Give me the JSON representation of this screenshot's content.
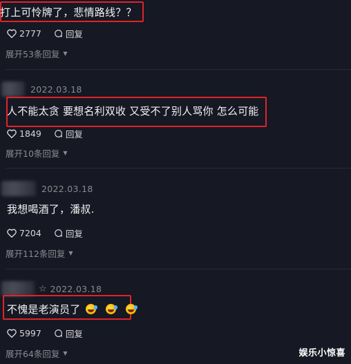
{
  "comments": [
    {
      "date": "",
      "text": "打上可怜牌了，悲情路线？？",
      "likes": "2777",
      "reply_label": "回复",
      "expand": "展开53条回复"
    },
    {
      "date": "2022.03.18",
      "text": "人不能太贪 要想名利双收 又受不了别人骂你 怎么可能",
      "likes": "1849",
      "reply_label": "回复",
      "expand": "展开10条回复"
    },
    {
      "date": "2022.03.18",
      "text": "我想喝酒了，潘叔.",
      "likes": "7204",
      "reply_label": "回复",
      "expand": "展开112条回复"
    },
    {
      "date": "2022.03.18",
      "text": "不愧是老演员了",
      "likes": "5997",
      "reply_label": "回复",
      "expand": "展开64条回复",
      "emojis": [
        "laughing-tears-emoji",
        "laughing-tears-emoji",
        "laughing-tears-emoji"
      ]
    }
  ],
  "watermark": "娱乐小惊喜",
  "colors": {
    "background": "#161823",
    "highlight": "#e0242a",
    "muted": "#8a8b91"
  }
}
